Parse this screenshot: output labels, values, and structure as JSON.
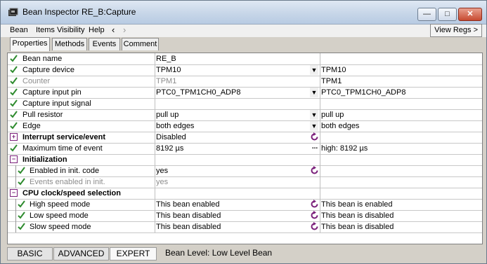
{
  "window": {
    "title": "Bean Inspector RE_B:Capture",
    "controls": {
      "minimize": "—",
      "maximize": "□",
      "close": "✕"
    }
  },
  "menu": {
    "items": [
      "Bean",
      "Items Visibility",
      "Help"
    ],
    "back": "‹",
    "forward": "›",
    "view_regs": "View Regs >"
  },
  "tabs": [
    {
      "label": "Properties",
      "active": true
    },
    {
      "label": "Methods",
      "active": false
    },
    {
      "label": "Events",
      "active": false
    },
    {
      "label": "Comment",
      "active": false
    }
  ],
  "properties": [
    {
      "name": "Bean name",
      "value": "RE_B",
      "current": "",
      "control": "none",
      "check": true,
      "indent": 0,
      "bold": false,
      "gray": false
    },
    {
      "name": "Capture device",
      "value": "TPM10",
      "current": "TPM10",
      "control": "dropdown",
      "check": true,
      "indent": 0,
      "bold": false,
      "gray": false
    },
    {
      "name": "Counter",
      "value": "TPM1",
      "current": "TPM1",
      "control": "none",
      "check": true,
      "indent": 0,
      "bold": false,
      "gray": true
    },
    {
      "name": "Capture input pin",
      "value": "PTC0_TPM1CH0_ADP8",
      "current": "PTC0_TPM1CH0_ADP8",
      "control": "dropdown",
      "check": true,
      "indent": 0,
      "bold": false,
      "gray": false
    },
    {
      "name": "Capture input signal",
      "value": "",
      "current": "",
      "control": "none",
      "check": true,
      "indent": 0,
      "bold": false,
      "gray": false
    },
    {
      "name": "Pull resistor",
      "value": "pull up",
      "current": "pull up",
      "control": "dropdown",
      "check": true,
      "indent": 0,
      "bold": false,
      "gray": false
    },
    {
      "name": "Edge",
      "value": "both edges",
      "current": "both edges",
      "control": "dropdown",
      "check": true,
      "indent": 0,
      "bold": false,
      "gray": false
    },
    {
      "name": "Interrupt service/event",
      "value": "Disabled",
      "current": "",
      "control": "toggle",
      "check": false,
      "expander": "+",
      "indent": 0,
      "bold": true,
      "gray": false
    },
    {
      "name": "Maximum time of event",
      "value": "8192 µs",
      "current": "high: 8192 µs",
      "control": "ellipsis",
      "check": true,
      "indent": 0,
      "bold": false,
      "gray": false
    },
    {
      "name": "Initialization",
      "value": "",
      "current": "",
      "control": "none",
      "check": false,
      "expander": "−",
      "indent": 0,
      "bold": true,
      "gray": false
    },
    {
      "name": "Enabled in init. code",
      "value": "yes",
      "current": "",
      "control": "toggle",
      "check": true,
      "indent": 1,
      "bold": false,
      "gray": false
    },
    {
      "name": "Events enabled in init.",
      "value": "yes",
      "current": "",
      "control": "none",
      "check": true,
      "indent": 1,
      "bold": false,
      "gray": true
    },
    {
      "name": "CPU clock/speed selection",
      "value": "",
      "current": "",
      "control": "none",
      "check": false,
      "expander": "−",
      "indent": 0,
      "bold": true,
      "gray": false
    },
    {
      "name": "High speed mode",
      "value": "This bean enabled",
      "current": "This bean is enabled",
      "control": "toggle",
      "check": true,
      "indent": 1,
      "bold": false,
      "gray": false
    },
    {
      "name": "Low speed mode",
      "value": "This bean disabled",
      "current": "This bean is disabled",
      "control": "toggle",
      "check": true,
      "indent": 1,
      "bold": false,
      "gray": false
    },
    {
      "name": "Slow speed mode",
      "value": "This bean disabled",
      "current": "This bean is disabled",
      "control": "toggle",
      "check": true,
      "indent": 1,
      "bold": false,
      "gray": false
    }
  ],
  "status": {
    "levels": [
      {
        "label": "BASIC",
        "active": false
      },
      {
        "label": "ADVANCED",
        "active": false
      },
      {
        "label": "EXPERT",
        "active": true
      }
    ],
    "bean_level": "Bean Level: Low Level Bean"
  },
  "colors": {
    "check": "#2e8b2e",
    "refresh": "#7a1f7a",
    "title_gradient_top": "#dfe8f3"
  }
}
